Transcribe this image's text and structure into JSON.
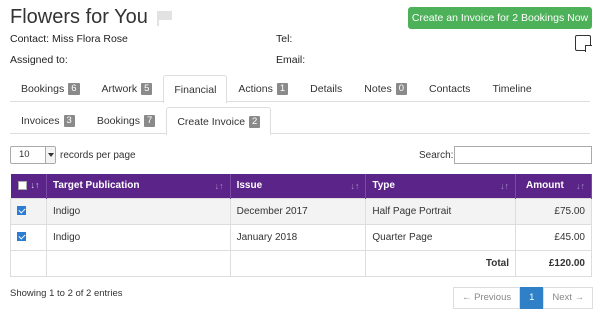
{
  "header": {
    "title": "Flowers for You",
    "create_button": "Create an Invoice for 2 Bookings Now",
    "contact": "Contact: Miss Flora Rose",
    "assigned": "Assigned to:",
    "tel": "Tel:",
    "email": "Email:"
  },
  "main_tabs": [
    {
      "label": "Bookings",
      "badge": "6"
    },
    {
      "label": "Artwork",
      "badge": "5"
    },
    {
      "label": "Financial",
      "badge": null
    },
    {
      "label": "Actions",
      "badge": "1"
    },
    {
      "label": "Details",
      "badge": null
    },
    {
      "label": "Notes",
      "badge": "0"
    },
    {
      "label": "Contacts",
      "badge": null
    },
    {
      "label": "Timeline",
      "badge": null
    }
  ],
  "sub_tabs": [
    {
      "label": "Invoices",
      "badge": "3"
    },
    {
      "label": "Bookings",
      "badge": "7"
    },
    {
      "label": "Create Invoice",
      "badge": "2"
    }
  ],
  "records": {
    "value": "10",
    "label": "records per page"
  },
  "search": {
    "label": "Search:"
  },
  "table": {
    "headers": [
      "Target Publication",
      "Issue",
      "Type",
      "Amount"
    ],
    "rows": [
      {
        "publication": "Indigo",
        "issue": "December 2017",
        "type": "Half Page Portrait",
        "amount": "£75.00"
      },
      {
        "publication": "Indigo",
        "issue": "January 2018",
        "type": "Quarter Page",
        "amount": "£45.00"
      }
    ],
    "total_label": "Total",
    "total_value": "£120.00"
  },
  "footer": {
    "showing": "Showing 1 to 2 of 2 entries",
    "prev": "← Previous",
    "page": "1",
    "next": "Next →"
  }
}
